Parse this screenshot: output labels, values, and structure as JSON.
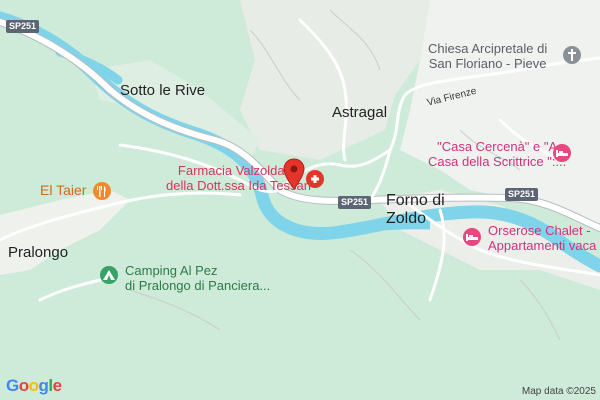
{
  "map": {
    "places": {
      "sotto_le_rive": "Sotto le Rive",
      "astragal": "Astragal",
      "forno_line1": "Forno di",
      "forno_line2": "Zoldo",
      "pralongo": "Pralongo"
    },
    "streets": {
      "via_firenze": "Via Firenze"
    },
    "road_shields": {
      "sp251_a": "SP251",
      "sp251_b": "SP251",
      "sp251_c": "SP251"
    },
    "pois": {
      "church_line1": "Chiesa Arcipretale di",
      "church_line2": "San Floriano - Pieve",
      "pharmacy_line1": "Farmacia Valzoldana",
      "pharmacy_line2": "della Dott.ssa Ida Tessari",
      "casa_line1": "\"Casa Cercenà\" e \"A",
      "casa_line2": "Casa della Scrittrice \":...",
      "el_taier": "El Taier",
      "orserose_line1": "Orserose Chalet -",
      "orserose_line2": "Appartamenti vaca",
      "camping_line1": "Camping Al Pez",
      "camping_line2": "di Pralongo di Panciera..."
    },
    "icons": {
      "pin": "red-location-pin",
      "church": "church-cross-icon",
      "pharmacy": "pharmacy-icon",
      "hotel": "hotel-bed-icon",
      "restaurant": "restaurant-icon",
      "camping": "camping-tent-icon"
    },
    "colors": {
      "land": "#cdebd8",
      "river": "#7fd4ea",
      "road": "#ffffff",
      "pin": "#e5352b",
      "pink_poi": "#e8487f",
      "orange_poi": "#f08a2c",
      "green_poi": "#37a266"
    },
    "attribution": "Map data ©2025",
    "logo": "Google"
  }
}
